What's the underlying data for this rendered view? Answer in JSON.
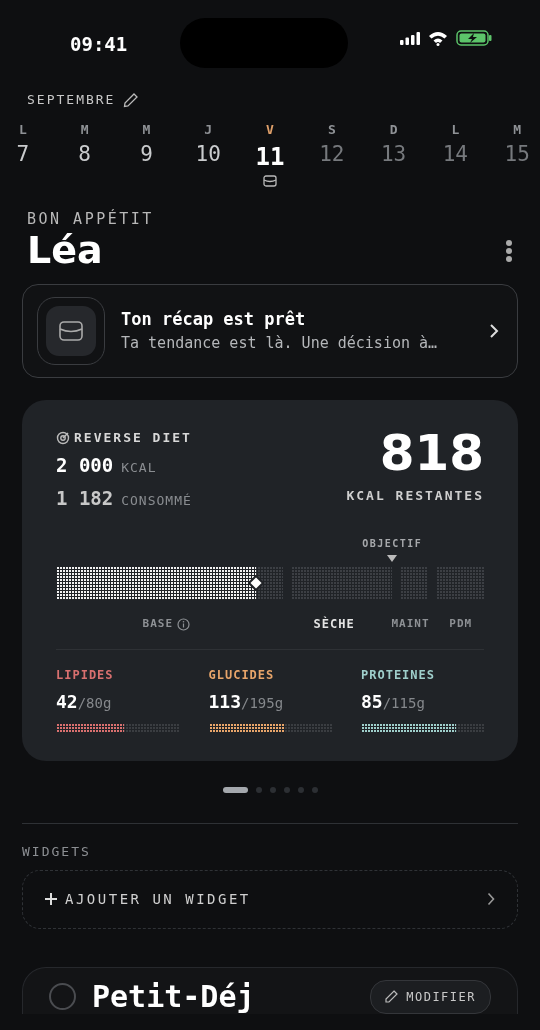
{
  "status_bar": {
    "time": "09:41"
  },
  "calendar": {
    "month": "SEPTEMBRE",
    "days": [
      {
        "weekday": "L",
        "day": "7",
        "selected": false,
        "upcoming": false
      },
      {
        "weekday": "M",
        "day": "8",
        "selected": false,
        "upcoming": false
      },
      {
        "weekday": "M",
        "day": "9",
        "selected": false,
        "upcoming": false
      },
      {
        "weekday": "J",
        "day": "10",
        "selected": false,
        "upcoming": false
      },
      {
        "weekday": "V",
        "day": "11",
        "selected": true,
        "upcoming": false
      },
      {
        "weekday": "S",
        "day": "12",
        "selected": false,
        "upcoming": true
      },
      {
        "weekday": "D",
        "day": "13",
        "selected": false,
        "upcoming": true
      },
      {
        "weekday": "L",
        "day": "14",
        "selected": false,
        "upcoming": true
      },
      {
        "weekday": "M",
        "day": "15",
        "selected": false,
        "upcoming": true
      }
    ]
  },
  "greeting": {
    "subtitle": "BON APPÉTIT",
    "name": "Léa"
  },
  "recap": {
    "title": "Ton récap est prêt",
    "text": "Ta tendance est là. Une décision à…"
  },
  "summary": {
    "program": "REVERSE DIET",
    "target": "2 000",
    "target_unit": "KCAL",
    "consumed": "1 182",
    "consumed_unit": "CONSOMMÉ",
    "remaining": "818",
    "remaining_label": "KCAL RESTANTES",
    "goal_label": "OBJECTIF",
    "segments": [
      {
        "label": "BASE",
        "level": 0.88,
        "selected": false,
        "info": true
      },
      {
        "label": "SÈCHE",
        "selected": true,
        "info": false
      },
      {
        "label": "MAINT",
        "selected": false,
        "info": false
      },
      {
        "label": "PDM",
        "selected": false,
        "info": false
      }
    ],
    "macros": [
      {
        "name": "LIPIDES",
        "value": "42",
        "total": "/80g",
        "color": "#d9706f",
        "level": 0.55
      },
      {
        "name": "GLUCIDES",
        "value": "113",
        "total": "/195g",
        "color": "#e8a56a",
        "level": 0.62
      },
      {
        "name": "PROTEINES",
        "value": "85",
        "total": "/115g",
        "color": "#9fcfcb",
        "level": 0.77
      }
    ]
  },
  "pager": [
    {
      "selected": true
    },
    {
      "selected": false
    },
    {
      "selected": false
    },
    {
      "selected": false
    },
    {
      "selected": false
    },
    {
      "selected": false
    }
  ],
  "widgets": {
    "heading": "WIDGETS",
    "add_label": "AJOUTER UN WIDGET"
  },
  "meal": {
    "title": "Petit-Déj",
    "checked": false,
    "edit_label": "MODIFIER"
  }
}
